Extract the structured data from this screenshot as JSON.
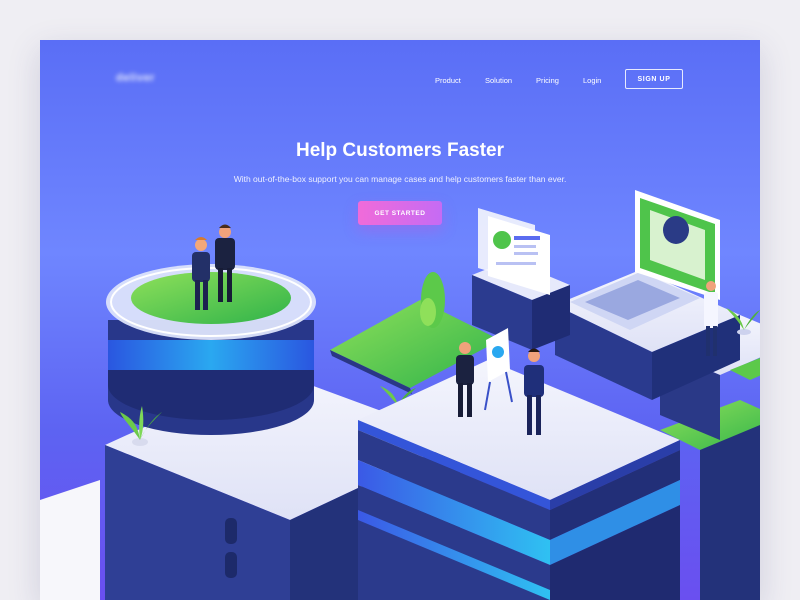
{
  "nav": {
    "logo_text": "deliver",
    "links": [
      {
        "label": "Product"
      },
      {
        "label": "Solution"
      },
      {
        "label": "Pricing"
      },
      {
        "label": "Login"
      }
    ],
    "signup_label": "SIGN UP"
  },
  "hero": {
    "title": "Help Customers Faster",
    "subtitle": "With out-of-the-box support you can manage cases and help customers faster than ever.",
    "cta_label": "GET STARTED"
  },
  "colors": {
    "bg_top": "#5a6ef6",
    "bg_bottom": "#6a4ff0",
    "cta_start": "#f06bd9",
    "cta_end": "#c56bf4",
    "platform_light": "#e9ebfa",
    "platform_side": "#27367f",
    "accent_blue": "#2aa8f0",
    "grass": "#5fc84a"
  },
  "illustration": {
    "icons": [
      "people-handshake",
      "presentation-board",
      "laptop-icon",
      "plant-icon",
      "scientist-figure",
      "document-panels"
    ]
  }
}
